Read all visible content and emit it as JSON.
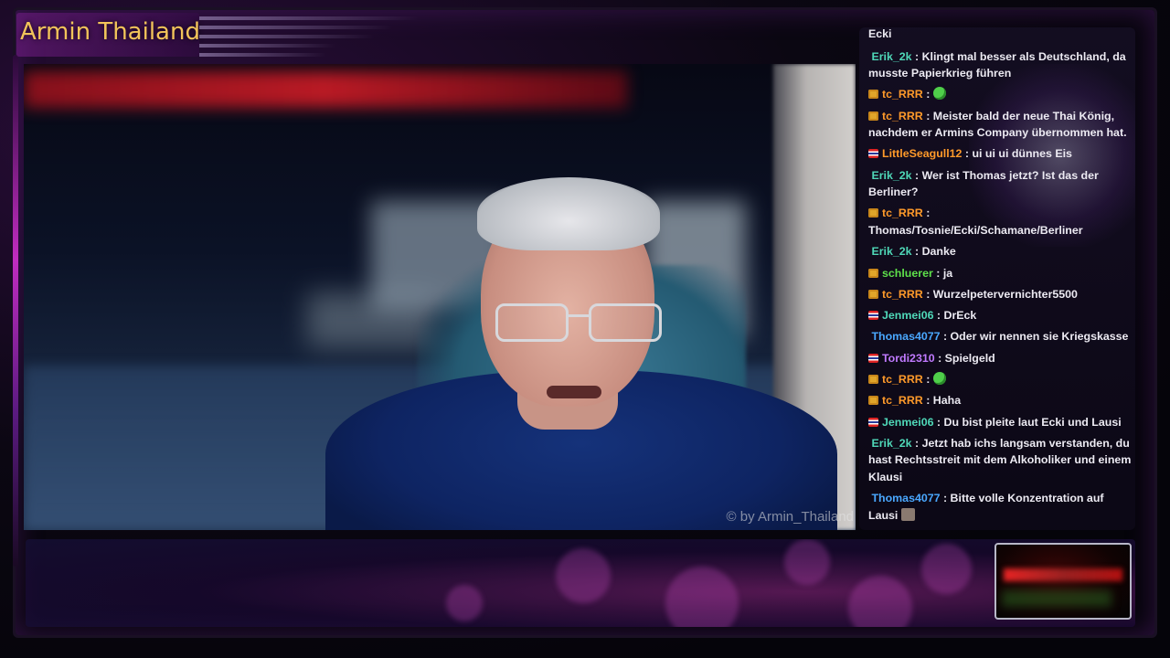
{
  "channel": {
    "title": "Armin Thailand"
  },
  "video": {
    "watermark": "© by Armin_Thailand"
  },
  "chat": {
    "header_user": "Ecki",
    "messages": [
      {
        "badge": "none",
        "user": "Erik_2k",
        "color": "#4fd8b8",
        "text": "Klingt mal besser als Deutschland, da musste Papierkrieg führen",
        "emote": ""
      },
      {
        "badge": "crown",
        "user": "tc_RRR",
        "color": "#ff9a2a",
        "text": "",
        "emote": "green-smile-emote"
      },
      {
        "badge": "crown",
        "user": "tc_RRR",
        "color": "#ff9a2a",
        "text": "Meister bald der neue Thai König, nachdem er Armins Company übernommen hat.",
        "emote": ""
      },
      {
        "badge": "flag",
        "user": "LittleSeagull12",
        "color": "#ff9a2a",
        "text": "ui ui ui dünnes Eis",
        "emote": ""
      },
      {
        "badge": "none",
        "user": "Erik_2k",
        "color": "#4fd8b8",
        "text": "Wer ist Thomas jetzt? Ist das der Berliner?",
        "emote": ""
      },
      {
        "badge": "crown",
        "user": "tc_RRR",
        "color": "#ff9a2a",
        "text": "Thomas/Tosnie/Ecki/Schamane/Berliner",
        "emote": ""
      },
      {
        "badge": "none",
        "user": "Erik_2k",
        "color": "#4fd8b8",
        "text": "Danke",
        "emote": ""
      },
      {
        "badge": "crown",
        "user": "schluerer",
        "color": "#5ee04a",
        "text": "ja",
        "emote": ""
      },
      {
        "badge": "crown",
        "user": "tc_RRR",
        "color": "#ff9a2a",
        "text": "Wurzelpetervernichter5500",
        "emote": ""
      },
      {
        "badge": "flag",
        "user": "Jenmei06",
        "color": "#4fd8b8",
        "text": "DrEck",
        "emote": ""
      },
      {
        "badge": "none",
        "user": "Thomas4077",
        "color": "#4aa8ff",
        "text": "Oder wir nennen sie Kriegskasse",
        "emote": ""
      },
      {
        "badge": "flag",
        "user": "Tordi2310",
        "color": "#c07aff",
        "text": "Spielgeld",
        "emote": ""
      },
      {
        "badge": "crown",
        "user": "tc_RRR",
        "color": "#ff9a2a",
        "text": "",
        "emote": "green-smile-emote"
      },
      {
        "badge": "crown",
        "user": "tc_RRR",
        "color": "#ff9a2a",
        "text": "Haha",
        "emote": ""
      },
      {
        "badge": "flag",
        "user": "Jenmei06",
        "color": "#4fd8b8",
        "text": "Du bist pleite laut Ecki und Lausi",
        "emote": ""
      },
      {
        "badge": "none",
        "user": "Erik_2k",
        "color": "#4fd8b8",
        "text": "Jetzt hab ichs langsam verstanden, du hast Rechtsstreit mit dem Alkoholiker und einem Klausi",
        "emote": ""
      },
      {
        "badge": "none",
        "user": "Thomas4077",
        "color": "#4aa8ff",
        "text": "Bitte volle Konzentration auf Lausi",
        "emote": "box-emote"
      }
    ]
  }
}
